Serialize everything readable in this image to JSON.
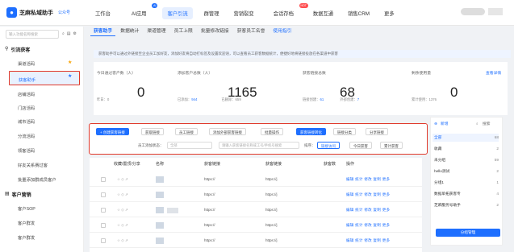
{
  "app": {
    "title": "芝麻私域助手",
    "version": "公众号"
  },
  "nav": [
    "工作台",
    "AI应用",
    "客户引流",
    "群管理",
    "营销裂变",
    "会话存档",
    "数据互通",
    "销售CRM",
    "更多"
  ],
  "nav_active": 2,
  "nav_badges": {
    "ai": "AI",
    "hot": "HOT"
  },
  "sidebar": {
    "search_placeholder": "输入功能名称搜索",
    "group1": "引流获客",
    "items1": [
      "渠道活码",
      "获客助手",
      "店铺活码",
      "门店活码",
      "城市活码",
      "分流活码",
      "领客活码",
      "好友关系赛过客",
      "批量添加群成员客户"
    ],
    "group2": "客户营销",
    "items2": [
      "客户SOP",
      "客户群发",
      "客户群发"
    ]
  },
  "tabs": [
    "获客助手",
    "数据统计",
    "渠道管理",
    "员工上限",
    "批量修改链接",
    "获客员工名誉",
    "使用指引"
  ],
  "banner": "获客助手可以通过外链接至企业员工加好友，添加好友将自动打标签及设置欢迎语，可以查看员工获客数据统计，便捷好地将链接投放在各渠道中获客",
  "stats": [
    {
      "label": "今日通过客户数（人）",
      "value": "0",
      "foot": "昨日：0"
    },
    {
      "label": "添加客户总数（人）",
      "value": "1165",
      "foot_a_label": "已添加：",
      "foot_a": "944",
      "foot_b_label": "已删除：",
      "foot_b": "659"
    },
    {
      "label": "获客链接总数",
      "value": "68",
      "foot_a_label": "链接创建：",
      "foot_a": "61",
      "foot_b_label": "外部创建：",
      "foot_b": "7"
    },
    {
      "label": "剩余使用量",
      "value": "0",
      "link": "查看详情",
      "foot": "累计使用：1376"
    }
  ],
  "toolbar": {
    "buttons": [
      "+ 创建获客链接",
      "获取链接",
      "员工链接",
      "添加外部获客链接",
      "批量操作",
      "获客链接转化",
      "链接分类",
      "分享链接"
    ],
    "status_label": "员工添加状态：",
    "status_value": "全部",
    "search_placeholder": "请输入获客链接名称或工号/手机号搜索",
    "sort_label": "排序：",
    "sort_a": "链接访问",
    "sort_b": "今日获客",
    "sort_c": "累计获客"
  },
  "table": {
    "headers": [
      "收藏/置顶/分享",
      "名称",
      "获客链接",
      "获客链接",
      "获客数",
      "操作"
    ],
    "link_text": "https://",
    "link_text2": "https://j",
    "ops": [
      "编辑",
      "统计",
      "修改",
      "复制",
      "更多"
    ]
  },
  "right_panel": {
    "new": "新增",
    "search": "搜索",
    "items": [
      [
        "全部",
        "68"
      ],
      [
        "收藏",
        "2"
      ],
      [
        "未分组",
        "59"
      ],
      [
        "hello测试",
        "2"
      ],
      [
        "分组1",
        "1"
      ],
      [
        "数据单拓获客专",
        "4"
      ],
      [
        "芝麻服务号助手",
        "2"
      ]
    ],
    "manage": "分组管理"
  }
}
